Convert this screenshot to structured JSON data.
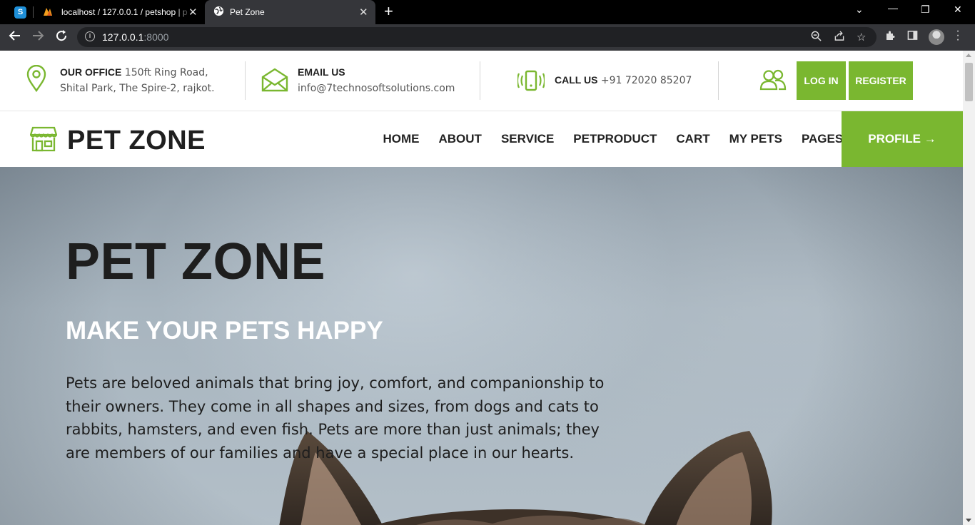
{
  "browser": {
    "tabs": [
      {
        "title": "localhost / 127.0.0.1 / petshop | p",
        "active": false
      },
      {
        "title": "Pet Zone",
        "active": true
      }
    ],
    "pinned_tab_icon": "S",
    "url_host": "127.0.0.1",
    "url_port": ":8000"
  },
  "topbar": {
    "office_label": "OUR OFFICE",
    "office_line1": "150ft Ring Road,",
    "office_line2": "Shital Park, The Spire-2, rajkot.",
    "email_label": "EMAIL US",
    "email_value": "info@7technosoftsolutions.com",
    "call_label": "CALL US",
    "call_value": "+91 72020 85207",
    "login_label": "LOG IN",
    "register_label": "REGISTER"
  },
  "navbar": {
    "brand": "PET ZONE",
    "menu": [
      "HOME",
      "ABOUT",
      "SERVICE",
      "PETPRODUCT",
      "CART",
      "MY PETS",
      "PAGES"
    ],
    "profile_label": "PROFILE →"
  },
  "hero": {
    "title": "PET ZONE",
    "subtitle": "MAKE YOUR PETS HAPPY",
    "paragraph": "Pets are beloved animals that bring joy, comfort, and companionship to their owners. They come in all shapes and sizes, from dogs and cats to rabbits, hamsters, and even fish. Pets are more than just animals; they are members of our families and have a special place in our hearts."
  },
  "colors": {
    "accent": "#7ab730",
    "text_dark": "#1e1e1e",
    "chrome_dark": "#35363a"
  }
}
